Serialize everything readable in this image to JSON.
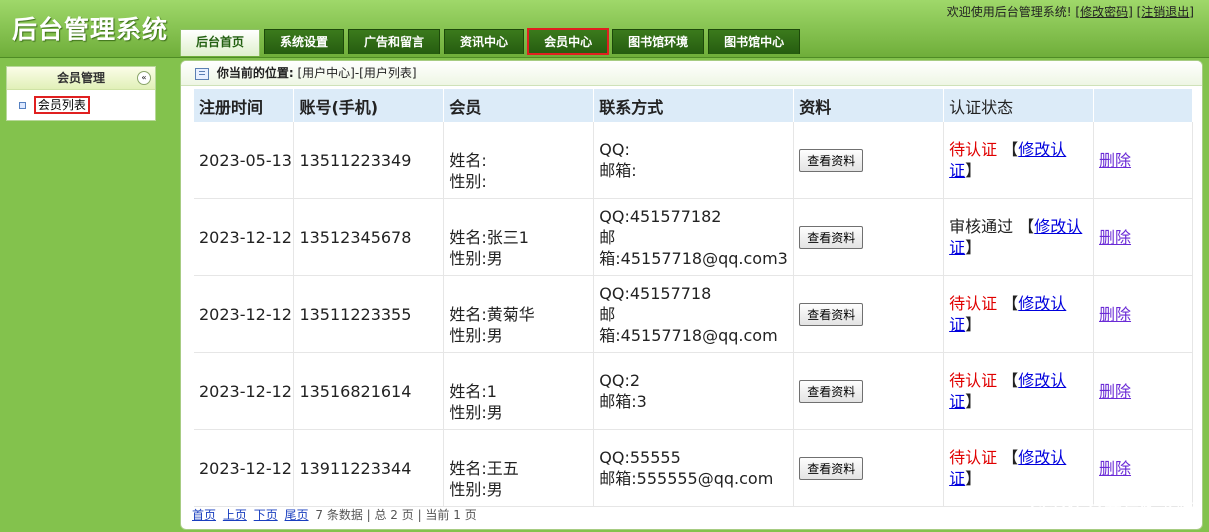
{
  "header": {
    "app_title": "后台管理系统",
    "welcome_text": "欢迎使用后台管理系统!",
    "change_password": "[修改密码]",
    "logout": "[注销退出]"
  },
  "tabs": [
    {
      "label": "后台首页",
      "active": true
    },
    {
      "label": "系统设置"
    },
    {
      "label": "广告和留言"
    },
    {
      "label": "资讯中心"
    },
    {
      "label": "会员中心",
      "highlighted": true
    },
    {
      "label": "图书馆环境"
    },
    {
      "label": "图书馆中心"
    }
  ],
  "sidebar": {
    "section_title": "会员管理",
    "toggle_symbol": "«",
    "items": [
      {
        "label": "会员列表"
      }
    ]
  },
  "breadcrumb": {
    "label": "你当前的位置:",
    "path": "[用户中心]-[用户列表]"
  },
  "table": {
    "headers": [
      "注册时间",
      "账号(手机)",
      "会员",
      "联系方式",
      "资料",
      "认证状态",
      ""
    ],
    "rows": [
      {
        "date": "2023-05-13",
        "phone": "13511223349",
        "name_line": "姓名:",
        "gender_line": "性别:",
        "qq_line": "QQ:",
        "email_line": "邮箱:",
        "view_label": "查看资料",
        "status": "待认证",
        "status_type": "pending",
        "bracket_open": "【",
        "modify_label": "修改认证",
        "bracket_close": "】",
        "delete_label": "删除"
      },
      {
        "date": "2023-12-12",
        "phone": "13512345678",
        "name_line": "姓名:张三1",
        "gender_line": "性别:男",
        "qq_line": "QQ:451577182",
        "email_line": "邮箱:45157718@qq.com3",
        "view_label": "查看资料",
        "status": "审核通过",
        "status_type": "approved",
        "bracket_open": "【",
        "modify_label": "修改认证",
        "bracket_close": "】",
        "delete_label": "删除"
      },
      {
        "date": "2023-12-12",
        "phone": "13511223355",
        "name_line": "姓名:黄菊华",
        "gender_line": "性别:男",
        "qq_line": "QQ:45157718",
        "email_line": "邮箱:45157718@qq.com",
        "view_label": "查看资料",
        "status": "待认证",
        "status_type": "pending",
        "bracket_open": "【",
        "modify_label": "修改认证",
        "bracket_close": "】",
        "delete_label": "删除"
      },
      {
        "date": "2023-12-12",
        "phone": "13516821614",
        "name_line": "姓名:1",
        "gender_line": "性别:男",
        "qq_line": "QQ:2",
        "email_line": "邮箱:3",
        "view_label": "查看资料",
        "status": "待认证",
        "status_type": "pending",
        "bracket_open": "【",
        "modify_label": "修改认证",
        "bracket_close": "】",
        "delete_label": "删除"
      },
      {
        "date": "2023-12-12",
        "phone": "13911223344",
        "name_line": "姓名:王五",
        "gender_line": "性别:男",
        "qq_line": "QQ:55555",
        "email_line": "邮箱:555555@qq.com",
        "view_label": "查看资料",
        "status": "待认证",
        "status_type": "pending",
        "bracket_open": "【",
        "modify_label": "修改认证",
        "bracket_close": "】",
        "delete_label": "删除"
      }
    ]
  },
  "pager": {
    "first": "首页",
    "prev": "上页",
    "next": "下页",
    "last": "尾页",
    "summary": "7 条数据 | 总 2 页 | 当前 1 页"
  },
  "watermark": "CSDN @黄菊华老师"
}
